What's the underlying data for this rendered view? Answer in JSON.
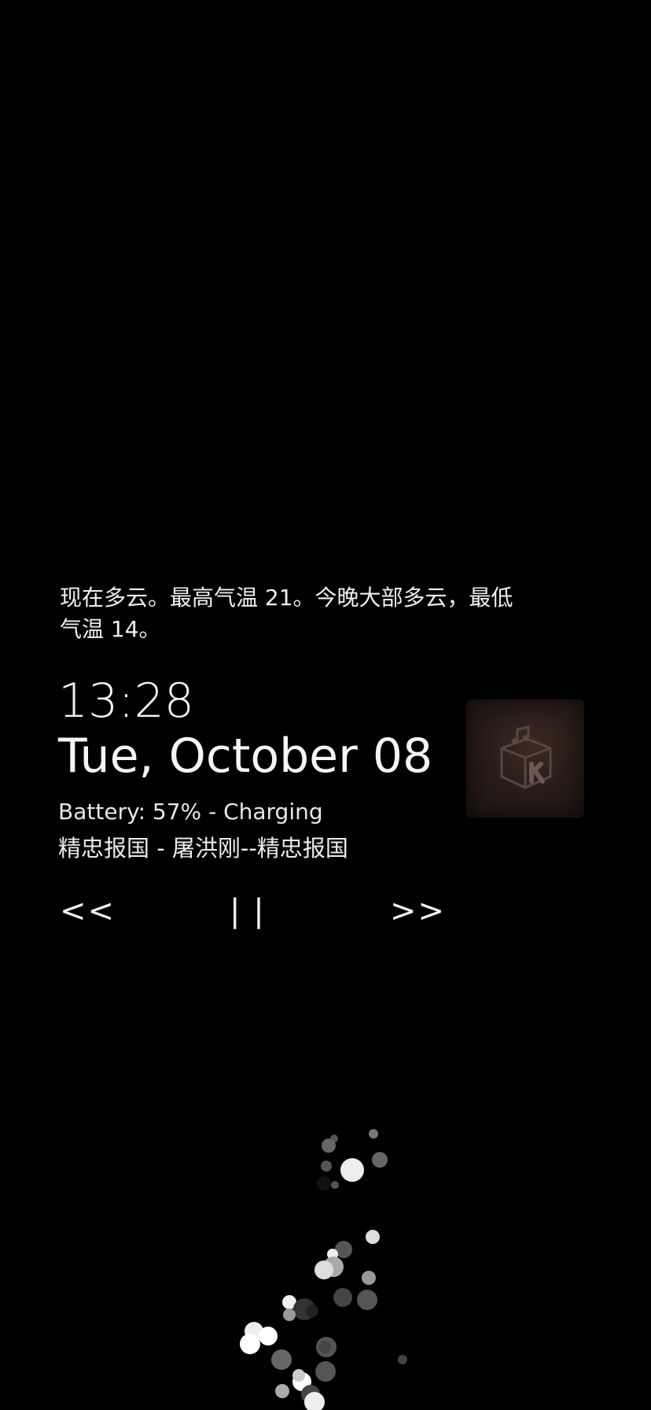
{
  "weather": {
    "line1": "现在多云。最高气温 21。今晚大部多云，最低",
    "line2": "气温 14。"
  },
  "clock": {
    "time": "13:28",
    "date": "Tue, October 08"
  },
  "status": {
    "battery": "Battery:  57% - Charging"
  },
  "media": {
    "now_playing": "精忠报国 - 屠洪刚--精忠报国",
    "prev_label": "<<",
    "pause_label": "| |",
    "next_label": ">>",
    "album_art_icon": "kuwo-music-box-icon"
  },
  "colors": {
    "background": "#000000",
    "text": "#f2f2f2"
  }
}
